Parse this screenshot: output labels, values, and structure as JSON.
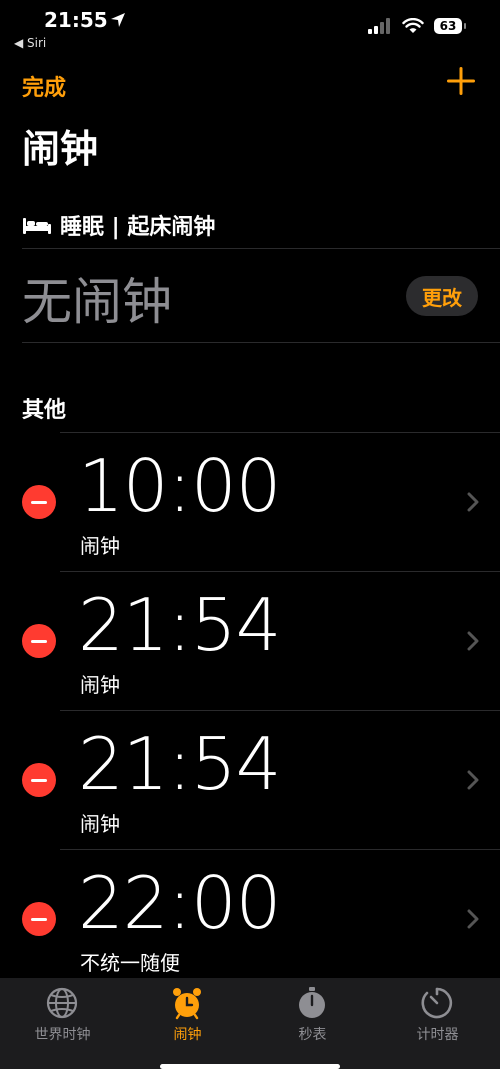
{
  "status": {
    "time": "21:55",
    "back_label": "◀ Siri",
    "battery": "63"
  },
  "nav": {
    "done_label": "完成",
    "title": "闹钟"
  },
  "sleep": {
    "header": "睡眠 | 起床闹钟",
    "no_alarm": "无闹钟",
    "change_label": "更改"
  },
  "other_label": "其他",
  "alarms": [
    {
      "time": "10:00",
      "label": "闹钟"
    },
    {
      "time": "21:54",
      "label": "闹钟"
    },
    {
      "time": "21:54",
      "label": "闹钟"
    },
    {
      "time": "22:00",
      "label": "不统一随便"
    }
  ],
  "tabs": [
    {
      "label": "世界时钟",
      "icon": "globe-icon",
      "active": false
    },
    {
      "label": "闹钟",
      "icon": "alarm-clock-icon",
      "active": true
    },
    {
      "label": "秒表",
      "icon": "stopwatch-icon",
      "active": false
    },
    {
      "label": "计时器",
      "icon": "timer-icon",
      "active": false
    }
  ],
  "colors": {
    "accent": "#ff9f0a",
    "delete": "#ff3b30",
    "background": "#000000",
    "tabbar": "#1c1c1e",
    "secondary_text": "#8e8e93"
  }
}
